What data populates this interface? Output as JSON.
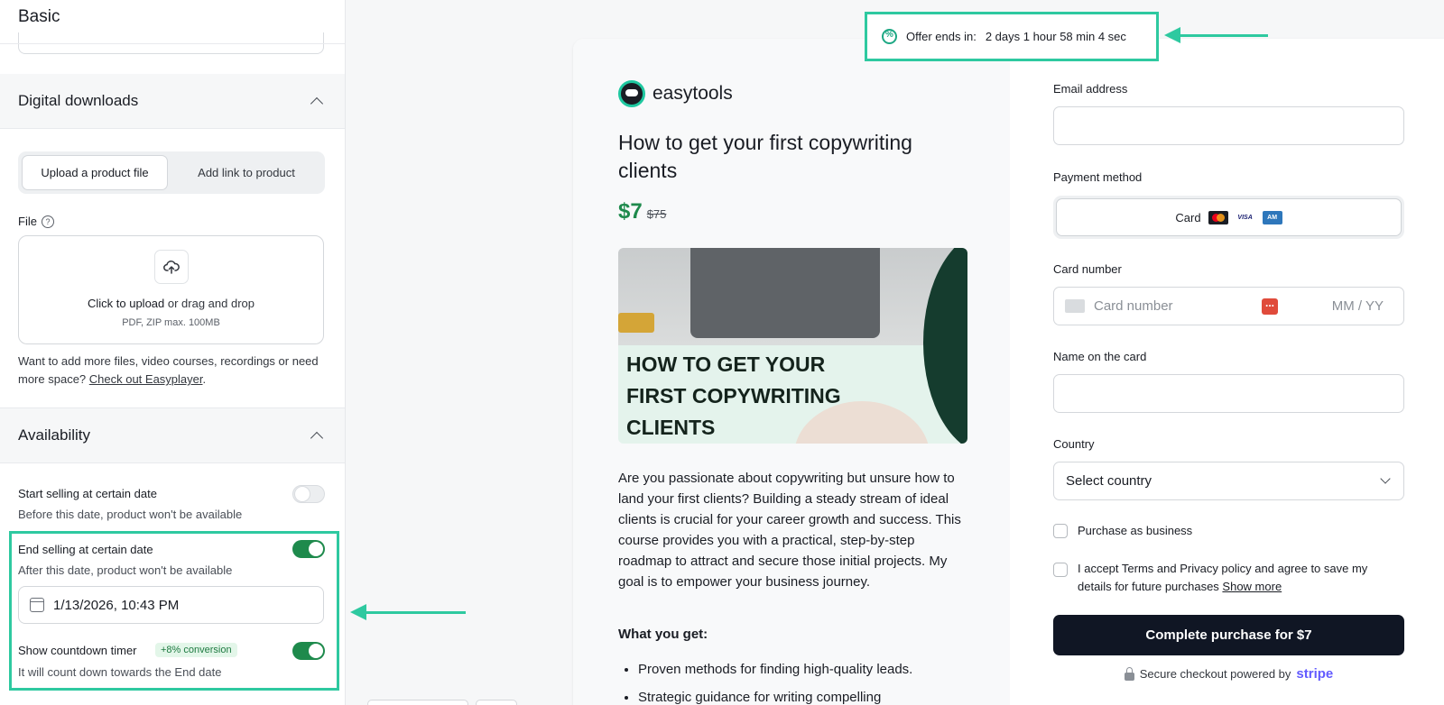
{
  "settings": {
    "basic_title": "Basic",
    "digital_downloads": {
      "title": "Digital downloads",
      "tabs": [
        "Upload a product file",
        "Add link to product"
      ],
      "file_label": "File",
      "help_icon_glyph": "?",
      "dropzone": {
        "click_text": "Click to upload",
        "drag_text": " or drag and drop",
        "formats": "PDF, ZIP max. 100MB"
      },
      "more_text": "Want to add more files, video courses, recordings or need more space? ",
      "more_link": "Check out Easyplayer",
      "more_end": "."
    },
    "availability": {
      "title": "Availability",
      "start_selling": {
        "title": "Start selling at certain date",
        "subtitle": "Before this date, product won't be available",
        "enabled": false
      },
      "end_selling": {
        "title": "End selling at certain date",
        "subtitle": "After this date, product won't be available",
        "enabled": true,
        "date_value": "1/13/2026, 10:43 PM"
      },
      "countdown": {
        "title": "Show countdown timer",
        "badge": "+8% conversion",
        "subtitle": "It will count down towards the End date",
        "enabled": true
      }
    }
  },
  "offer_banner": {
    "label": "Offer ends in:",
    "countdown": "2 days 1 hour 58 min 4 sec"
  },
  "product": {
    "brand": "easytools",
    "title": "How to get your first copywriting clients",
    "price": "$7",
    "old_price": "$75",
    "hero_text": "HOW TO GET YOUR FIRST COPYWRITING CLIENTS",
    "description": "Are you passionate about copywriting but unsure how to land your first clients? Building a steady stream of ideal clients is crucial for your career growth and success. This course provides you with a practical, step-by-step roadmap to attract and secure those initial projects. My goal is to empower your business journey.",
    "what_you_get": "What you get:",
    "bullets": [
      "Proven methods for finding high-quality leads.",
      "Strategic guidance for writing compelling"
    ]
  },
  "checkout": {
    "email_label": "Email address",
    "payment_label": "Payment method",
    "payment_option": "Card",
    "card_brands": [
      "mastercard",
      "visa",
      "amex"
    ],
    "visa_text": "VISA",
    "amex_text": "AM",
    "card_number_label": "Card number",
    "card_number_placeholder": "Card number",
    "expiry_placeholder": "MM / YY",
    "name_label": "Name on the card",
    "country_label": "Country",
    "country_value": "Select country",
    "business_label": "Purchase as business",
    "terms_text": "I accept Terms and Privacy policy and agree to save my details for future purchases ",
    "terms_link": "Show more",
    "buy_label": "Complete purchase for $7",
    "secure_text": "Secure checkout powered by",
    "stripe_text": "stripe"
  },
  "colors": {
    "accent_highlight": "#2ec9a0",
    "brand_green": "#1e8a4c",
    "buy_button": "#101624"
  }
}
